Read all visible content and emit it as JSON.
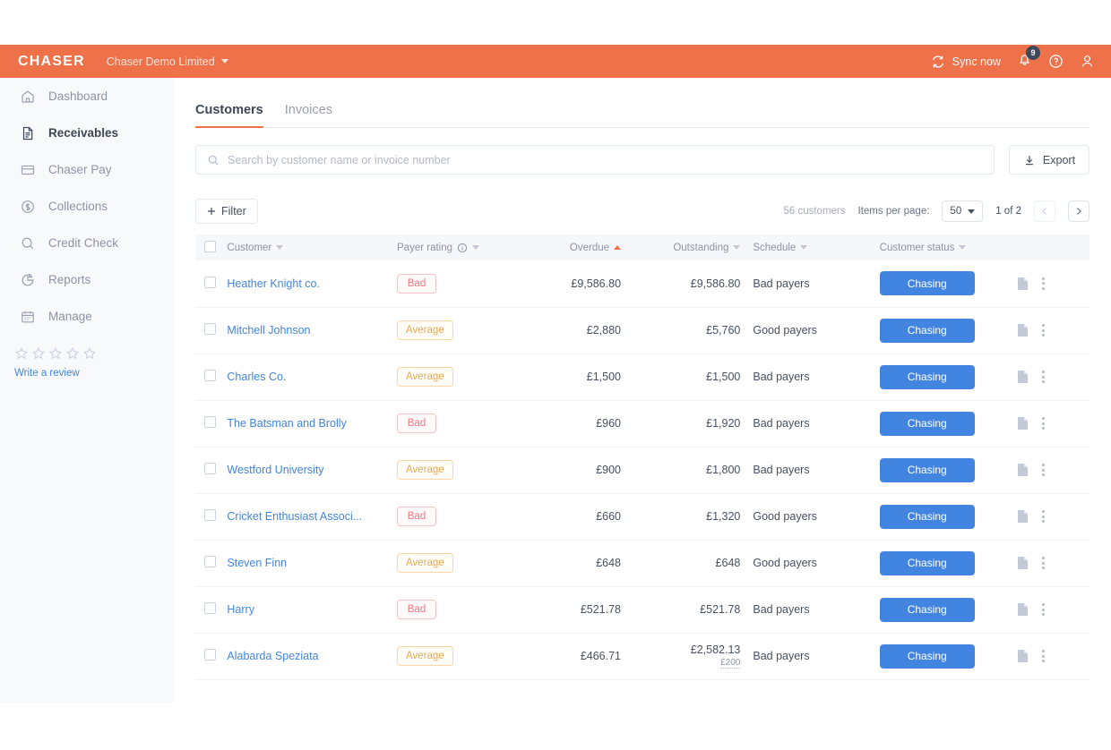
{
  "topbar": {
    "logo": "CHASER",
    "org": "Chaser Demo Limited",
    "sync_label": "Sync now",
    "notification_count": "9",
    "accent_color": "#ef7149"
  },
  "sidebar": {
    "items": [
      {
        "label": "Dashboard",
        "icon": "home-icon",
        "active": false
      },
      {
        "label": "Receivables",
        "icon": "document-icon",
        "active": true
      },
      {
        "label": "Chaser Pay",
        "icon": "card-icon",
        "active": false
      },
      {
        "label": "Collections",
        "icon": "dollar-circle-icon",
        "active": false
      },
      {
        "label": "Credit Check",
        "icon": "search-icon",
        "active": false
      },
      {
        "label": "Reports",
        "icon": "pie-chart-icon",
        "active": false
      },
      {
        "label": "Manage",
        "icon": "calendar-icon",
        "active": false
      }
    ],
    "review": {
      "stars": 5,
      "link_label": "Write a review"
    }
  },
  "main": {
    "tabs": [
      {
        "label": "Customers",
        "active": true
      },
      {
        "label": "Invoices",
        "active": false
      }
    ],
    "search": {
      "placeholder": "Search by customer name or invoice number",
      "value": ""
    },
    "export_label": "Export",
    "filter_label": "Filter",
    "customer_count": "56 customers",
    "items_per_page_label": "Items per page:",
    "items_per_page_value": "50",
    "page_indicator": "1 of 2"
  },
  "table": {
    "columns": [
      {
        "label": "Customer",
        "sort": "none",
        "align": "left"
      },
      {
        "label": "Payer rating",
        "sort": "none",
        "align": "left",
        "info": true
      },
      {
        "label": "Overdue",
        "sort": "asc",
        "align": "right"
      },
      {
        "label": "Outstanding",
        "sort": "none",
        "align": "right"
      },
      {
        "label": "Schedule",
        "sort": "none",
        "align": "left"
      },
      {
        "label": "Customer status",
        "sort": "none",
        "align": "left"
      }
    ],
    "rows": [
      {
        "customer": "Heather Knight co.",
        "rating": "Bad",
        "rating_type": "bad",
        "overdue": "£9,586.80",
        "outstanding": "£9,586.80",
        "outstanding_sub": "",
        "schedule": "Bad payers",
        "status": "Chasing"
      },
      {
        "customer": "Mitchell Johnson",
        "rating": "Average",
        "rating_type": "average",
        "overdue": "£2,880",
        "outstanding": "£5,760",
        "outstanding_sub": "",
        "schedule": "Good payers",
        "status": "Chasing"
      },
      {
        "customer": "Charles Co.",
        "rating": "Average",
        "rating_type": "average",
        "overdue": "£1,500",
        "outstanding": "£1,500",
        "outstanding_sub": "",
        "schedule": "Bad payers",
        "status": "Chasing"
      },
      {
        "customer": "The Batsman and Brolly",
        "rating": "Bad",
        "rating_type": "bad",
        "overdue": "£960",
        "outstanding": "£1,920",
        "outstanding_sub": "",
        "schedule": "Bad payers",
        "status": "Chasing"
      },
      {
        "customer": "Westford University",
        "rating": "Average",
        "rating_type": "average",
        "overdue": "£900",
        "outstanding": "£1,800",
        "outstanding_sub": "",
        "schedule": "Bad payers",
        "status": "Chasing"
      },
      {
        "customer": "Cricket Enthusiast Associ...",
        "rating": "Bad",
        "rating_type": "bad",
        "overdue": "£660",
        "outstanding": "£1,320",
        "outstanding_sub": "",
        "schedule": "Good payers",
        "status": "Chasing"
      },
      {
        "customer": "Steven Finn",
        "rating": "Average",
        "rating_type": "average",
        "overdue": "£648",
        "outstanding": "£648",
        "outstanding_sub": "",
        "schedule": "Good payers",
        "status": "Chasing"
      },
      {
        "customer": "Harry",
        "rating": "Bad",
        "rating_type": "bad",
        "overdue": "£521.78",
        "outstanding": "£521.78",
        "outstanding_sub": "",
        "schedule": "Bad payers",
        "status": "Chasing"
      },
      {
        "customer": "Alabarda Speziata",
        "rating": "Average",
        "rating_type": "average",
        "overdue": "£466.71",
        "outstanding": "£2,582.13",
        "outstanding_sub": "£200",
        "schedule": "Bad payers",
        "status": "Chasing"
      }
    ]
  }
}
